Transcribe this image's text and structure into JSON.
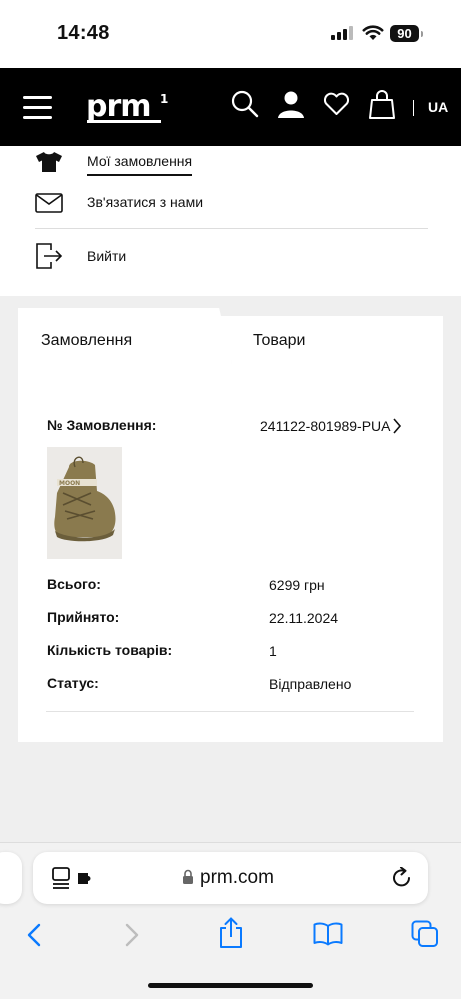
{
  "status_bar": {
    "time": "14:48",
    "battery": "90"
  },
  "header": {
    "logo": "prm",
    "lang": "UA"
  },
  "menu": {
    "items": [
      {
        "label": "Мої замовлення",
        "icon": "tshirt-icon"
      },
      {
        "label": "Зв'язатися з нами",
        "icon": "envelope-icon"
      },
      {
        "label": "Вийти",
        "icon": "logout-icon"
      }
    ]
  },
  "tabs": [
    {
      "label": "Замовлення",
      "active": true
    },
    {
      "label": "Товари",
      "active": false
    }
  ],
  "order": {
    "number_label": "№ Замовлення:",
    "number": "241122-801989-PUA",
    "rows": [
      {
        "label": "Всього:",
        "value": "6299 грн"
      },
      {
        "label": "Прийнято:",
        "value": "22.11.2024"
      },
      {
        "label": "Кількість товарів:",
        "value": "1"
      },
      {
        "label": "Статус:",
        "value": "Відправлено"
      }
    ]
  },
  "browser": {
    "url": "prm.com"
  },
  "colors": {
    "header_bg": "#000000",
    "browser_accent": "#0a7aff",
    "product": "#8a7a4e"
  }
}
